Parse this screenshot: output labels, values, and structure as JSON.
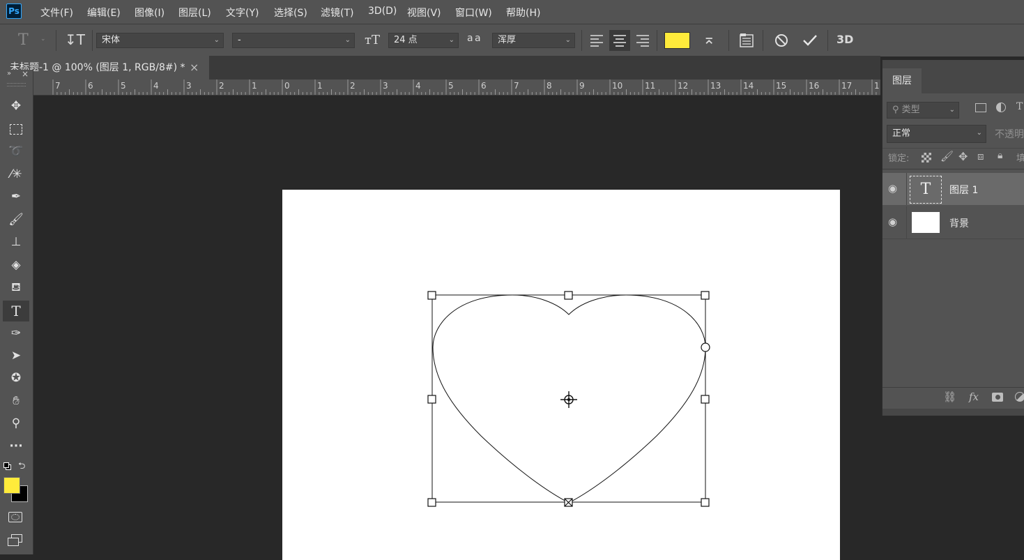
{
  "app": {
    "logo": "Ps"
  },
  "menu": [
    "文件(F)",
    "编辑(E)",
    "图像(I)",
    "图层(L)",
    "文字(Y)",
    "选择(S)",
    "滤镜(T)",
    "3D(D)",
    "视图(V)",
    "窗口(W)",
    "帮助(H)"
  ],
  "options": {
    "font_family": "宋体",
    "font_style": "-",
    "font_size": "24 点",
    "anti_alias_label": "a a",
    "anti_alias": "浑厚",
    "color": "#ffeb3b",
    "threed_label": "3D"
  },
  "document": {
    "tab_title": "未标题-1 @ 100% (图层 1, RGB/8#) *",
    "close": "×"
  },
  "ruler": {
    "numbers": [
      "7",
      "6",
      "5",
      "4",
      "3",
      "2",
      "1",
      "0",
      "1",
      "2",
      "3",
      "4",
      "5",
      "6",
      "7",
      "8",
      "9",
      "10",
      "11",
      "12",
      "13",
      "14",
      "15",
      "16",
      "17",
      "1"
    ]
  },
  "colors": {
    "foreground": "#ffeb3b",
    "background": "#000000"
  },
  "layers_panel": {
    "title": "图层",
    "filter_placeholder": "类型",
    "blend_mode": "正常",
    "opacity_label": "不透明",
    "lock_label": "锁定:",
    "fill_label": "填",
    "layers": [
      {
        "name": "图层 1",
        "type": "text",
        "selected": true
      },
      {
        "name": "背景",
        "type": "image",
        "selected": false
      }
    ]
  }
}
